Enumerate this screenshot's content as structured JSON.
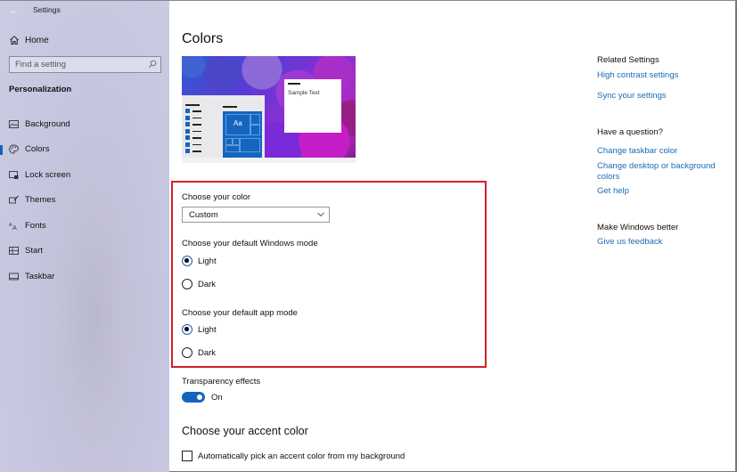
{
  "window": {
    "title": "Settings",
    "back_icon": "←"
  },
  "sidebar": {
    "home_label": "Home",
    "search": {
      "placeholder": "Find a setting"
    },
    "section_title": "Personalization",
    "accent_color": "#1a5fb4",
    "items": [
      {
        "label": "Background",
        "icon": "background-icon",
        "active": false
      },
      {
        "label": "Colors",
        "icon": "palette-icon",
        "active": true
      },
      {
        "label": "Lock screen",
        "icon": "lock-screen-icon",
        "active": false
      },
      {
        "label": "Themes",
        "icon": "themes-icon",
        "active": false
      },
      {
        "label": "Fonts",
        "icon": "fonts-icon",
        "active": false
      },
      {
        "label": "Start",
        "icon": "start-icon",
        "active": false
      },
      {
        "label": "Taskbar",
        "icon": "taskbar-icon",
        "active": false
      }
    ]
  },
  "main": {
    "title": "Colors",
    "preview": {
      "tile_label": "Aa",
      "sample_text": "Sample Text"
    },
    "choose_color": {
      "label": "Choose your color",
      "selected": "Custom"
    },
    "windows_mode": {
      "label": "Choose your default Windows mode",
      "options": [
        {
          "label": "Light",
          "checked": true
        },
        {
          "label": "Dark",
          "checked": false
        }
      ]
    },
    "app_mode": {
      "label": "Choose your default app mode",
      "options": [
        {
          "label": "Light",
          "checked": true
        },
        {
          "label": "Dark",
          "checked": false
        }
      ]
    },
    "transparency": {
      "label": "Transparency effects",
      "state": "On",
      "on": true
    },
    "accent": {
      "heading": "Choose your accent color",
      "auto_pick_label": "Automatically pick an accent color from my background",
      "auto_pick_checked": false
    },
    "highlight_color": "#d4202a",
    "accent_blue": "#1565c0"
  },
  "related": {
    "related_settings_heading": "Related Settings",
    "related_links": [
      "High contrast settings",
      "Sync your settings"
    ],
    "question_heading": "Have a question?",
    "question_links": [
      "Change taskbar color",
      "Change desktop or background colors",
      "Get help"
    ],
    "better_heading": "Make Windows better",
    "better_links": [
      "Give us feedback"
    ],
    "link_color": "#1a6ab4"
  }
}
